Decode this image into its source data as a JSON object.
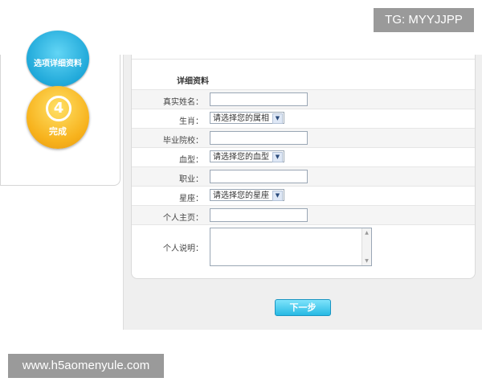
{
  "watermark": {
    "top": "TG: MYYJJPP",
    "bottom": "www.h5aomenyule.com"
  },
  "steps": {
    "step3_label": "选项详细资料",
    "step4_number": "4",
    "step4_label": "完成"
  },
  "form": {
    "section_title": "详细资料",
    "fields": {
      "real_name": {
        "label": "真实姓名：",
        "value": ""
      },
      "zodiac_animal": {
        "label": "生肖：",
        "value": "请选择您的属相"
      },
      "school": {
        "label": "毕业院校：",
        "value": ""
      },
      "blood_type": {
        "label": "血型：",
        "value": "请选择您的血型"
      },
      "occupation": {
        "label": "职业：",
        "value": ""
      },
      "star_sign": {
        "label": "星座：",
        "value": "请选择您的星座"
      },
      "homepage": {
        "label": "个人主页：",
        "value": ""
      },
      "bio": {
        "label": "个人说明：",
        "value": ""
      }
    }
  },
  "buttons": {
    "next": "下一步"
  }
}
